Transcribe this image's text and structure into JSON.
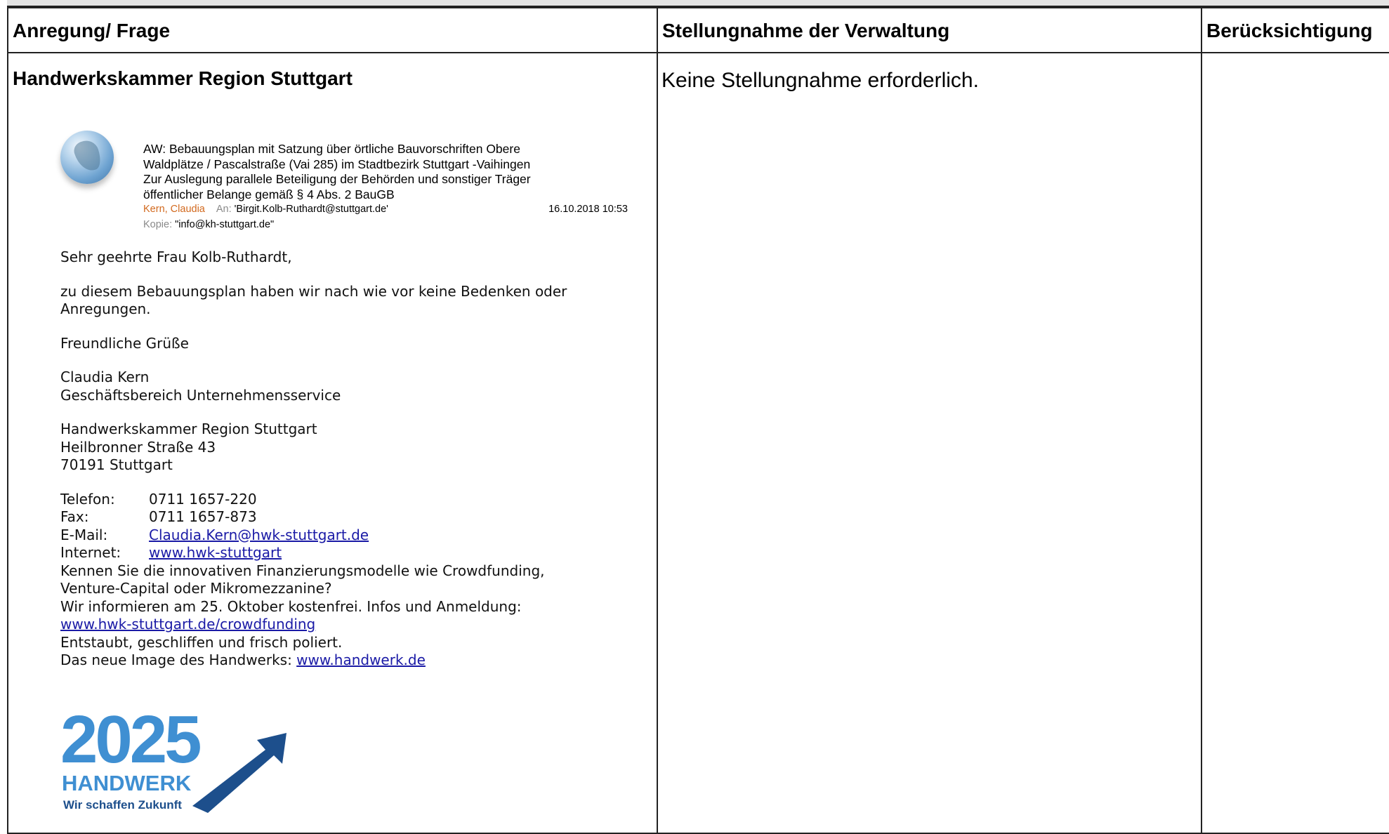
{
  "table": {
    "headers": {
      "col1": "Anregung/ Frage",
      "col2": "Stellungnahme der Verwaltung",
      "col3": "Berücksichtigung"
    },
    "row": {
      "title": "Handwerkskammer Region Stuttgart",
      "statement": "Keine Stellungnahme erforderlich.",
      "consideration": ""
    }
  },
  "email": {
    "subject_lines": [
      "AW: Bebauungsplan mit Satzung über örtliche Bauvorschriften Obere",
      "Waldplätze / Pascalstraße (Vai 285) im Stadtbezirk Stuttgart -Vaihingen",
      "Zur Auslegung parallele Beteiligung der Behörden und sonstiger Träger",
      "öffentlicher Belange gemäß §  4 Abs. 2 BauGB"
    ],
    "sender": "Kern, Claudia",
    "to_label": "An:",
    "to_value": "'Birgit.Kolb-Ruthardt@stuttgart.de'",
    "date": "16.10.2018 10:53",
    "cc_label": "Kopie:",
    "cc_value": "\"info@kh-stuttgart.de\"",
    "greeting": "Sehr geehrte Frau Kolb-Ruthardt,",
    "body_line1": "zu diesem Bebauungsplan haben wir nach wie vor keine Bedenken oder",
    "body_line2": "Anregungen.",
    "closing": "Freundliche Grüße",
    "name": "Claudia Kern",
    "department": "Geschäftsbereich Unternehmensservice",
    "org": "Handwerkskammer Region Stuttgart",
    "street": "Heilbronner Straße 43",
    "city": "70191 Stuttgart",
    "phone_label": "Telefon:",
    "phone": "0711 1657-220",
    "fax_label": "Fax:",
    "fax": "0711 1657-873",
    "email_label": "E-Mail:",
    "email_link": "Claudia.Kern@hwk-stuttgart.de",
    "internet_label": "Internet:",
    "internet_link": "www.hwk-stuttgart",
    "promo1": "Kennen Sie die innovativen Finanzierungsmodelle wie Crowdfunding,",
    "promo2": "Venture-Capital oder Mikromezzanine?",
    "promo3": "Wir informieren am 25. Oktober kostenfrei. Infos und Anmeldung:",
    "promo_link": "www.hwk-stuttgart.de/crowdfunding",
    "promo4": "Entstaubt, geschliffen und frisch poliert.",
    "promo5_prefix": "Das neue Image des Handwerks: ",
    "promo5_link": "www.handwerk.de"
  },
  "logo": {
    "year": "2025",
    "word": "HANDWERK",
    "tagline": "Wir schaffen Zukunft",
    "color_primary": "#3f8fd2",
    "color_dark": "#1d4f8c"
  }
}
